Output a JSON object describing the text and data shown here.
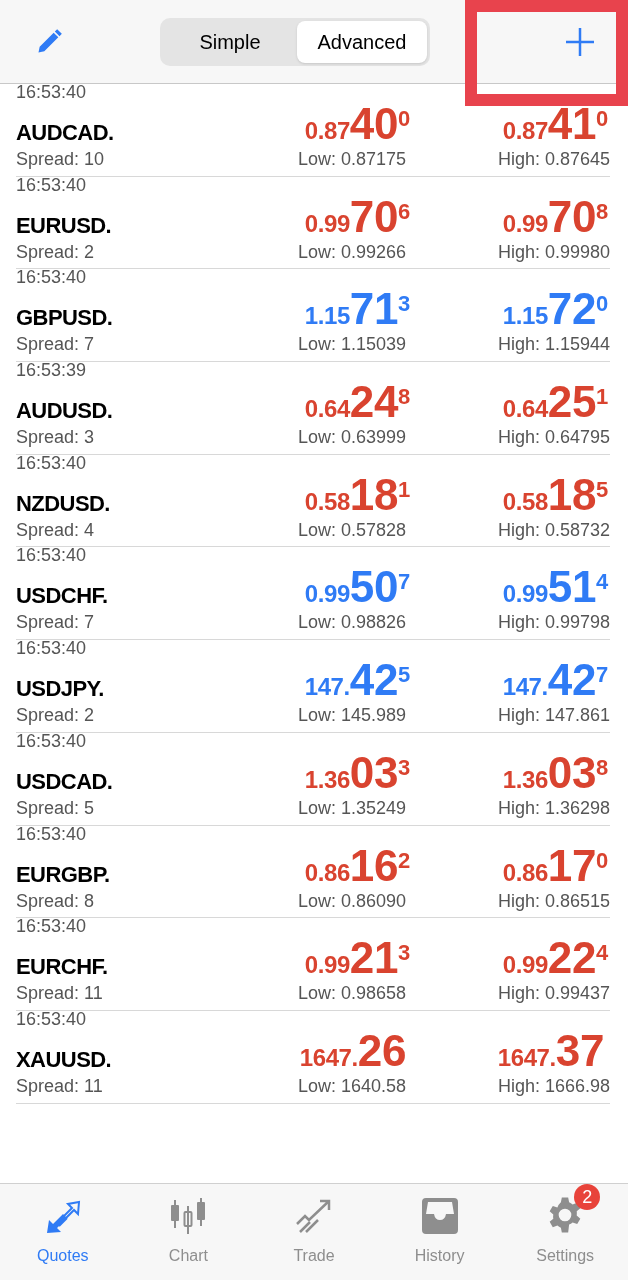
{
  "toolbar": {
    "segments": [
      {
        "label": "Simple",
        "selected": false
      },
      {
        "label": "Advanced",
        "selected": true
      }
    ],
    "add_button": {
      "highlighted": true
    }
  },
  "quotes": [
    {
      "time": "16:53:40",
      "symbol": "AUDCAD.",
      "spread": "Spread: 10",
      "rising": false,
      "bid": {
        "small": "0.87",
        "big": "40",
        "sup": "0"
      },
      "ask": {
        "small": "0.87",
        "big": "41",
        "sup": "0"
      },
      "low": "Low: 0.87175",
      "high": "High: 0.87645"
    },
    {
      "time": "16:53:40",
      "symbol": "EURUSD.",
      "spread": "Spread: 2",
      "rising": false,
      "bid": {
        "small": "0.99",
        "big": "70",
        "sup": "6"
      },
      "ask": {
        "small": "0.99",
        "big": "70",
        "sup": "8"
      },
      "low": "Low: 0.99266",
      "high": "High: 0.99980"
    },
    {
      "time": "16:53:40",
      "symbol": "GBPUSD.",
      "spread": "Spread: 7",
      "rising": true,
      "bid": {
        "small": "1.15",
        "big": "71",
        "sup": "3"
      },
      "ask": {
        "small": "1.15",
        "big": "72",
        "sup": "0"
      },
      "low": "Low: 1.15039",
      "high": "High: 1.15944"
    },
    {
      "time": "16:53:39",
      "symbol": "AUDUSD.",
      "spread": "Spread: 3",
      "rising": false,
      "bid": {
        "small": "0.64",
        "big": "24",
        "sup": "8"
      },
      "ask": {
        "small": "0.64",
        "big": "25",
        "sup": "1"
      },
      "low": "Low: 0.63999",
      "high": "High: 0.64795"
    },
    {
      "time": "16:53:40",
      "symbol": "NZDUSD.",
      "spread": "Spread: 4",
      "rising": false,
      "bid": {
        "small": "0.58",
        "big": "18",
        "sup": "1"
      },
      "ask": {
        "small": "0.58",
        "big": "18",
        "sup": "5"
      },
      "low": "Low: 0.57828",
      "high": "High: 0.58732"
    },
    {
      "time": "16:53:40",
      "symbol": "USDCHF.",
      "spread": "Spread: 7",
      "rising": true,
      "bid": {
        "small": "0.99",
        "big": "50",
        "sup": "7"
      },
      "ask": {
        "small": "0.99",
        "big": "51",
        "sup": "4"
      },
      "low": "Low: 0.98826",
      "high": "High: 0.99798"
    },
    {
      "time": "16:53:40",
      "symbol": "USDJPY.",
      "spread": "Spread: 2",
      "rising": true,
      "bid": {
        "small": "147.",
        "big": "42",
        "sup": "5"
      },
      "ask": {
        "small": "147.",
        "big": "42",
        "sup": "7"
      },
      "low": "Low: 145.989",
      "high": "High: 147.861"
    },
    {
      "time": "16:53:40",
      "symbol": "USDCAD.",
      "spread": "Spread: 5",
      "rising": false,
      "bid": {
        "small": "1.36",
        "big": "03",
        "sup": "3"
      },
      "ask": {
        "small": "1.36",
        "big": "03",
        "sup": "8"
      },
      "low": "Low: 1.35249",
      "high": "High: 1.36298"
    },
    {
      "time": "16:53:40",
      "symbol": "EURGBP.",
      "spread": "Spread: 8",
      "rising": false,
      "bid": {
        "small": "0.86",
        "big": "16",
        "sup": "2"
      },
      "ask": {
        "small": "0.86",
        "big": "17",
        "sup": "0"
      },
      "low": "Low: 0.86090",
      "high": "High: 0.86515"
    },
    {
      "time": "16:53:40",
      "symbol": "EURCHF.",
      "spread": "Spread: 11",
      "rising": false,
      "bid": {
        "small": "0.99",
        "big": "21",
        "sup": "3"
      },
      "ask": {
        "small": "0.99",
        "big": "22",
        "sup": "4"
      },
      "low": "Low: 0.98658",
      "high": "High: 0.99437"
    },
    {
      "time": "16:53:40",
      "symbol": "XAUUSD.",
      "spread": "Spread: 11",
      "rising": false,
      "bid": {
        "small": "1647.",
        "big": "26"
      },
      "ask": {
        "small": "1647.",
        "big": "37"
      },
      "low": "Low: 1640.58",
      "high": "High: 1666.98"
    }
  ],
  "tab_bar": [
    {
      "kind": "quotes",
      "label": "Quotes",
      "selected": true
    },
    {
      "kind": "chart",
      "label": "Chart",
      "selected": false
    },
    {
      "kind": "trade",
      "label": "Trade",
      "selected": false
    },
    {
      "kind": "history",
      "label": "History",
      "selected": false
    },
    {
      "kind": "settings",
      "label": "Settings",
      "selected": false,
      "badge": "2"
    }
  ]
}
